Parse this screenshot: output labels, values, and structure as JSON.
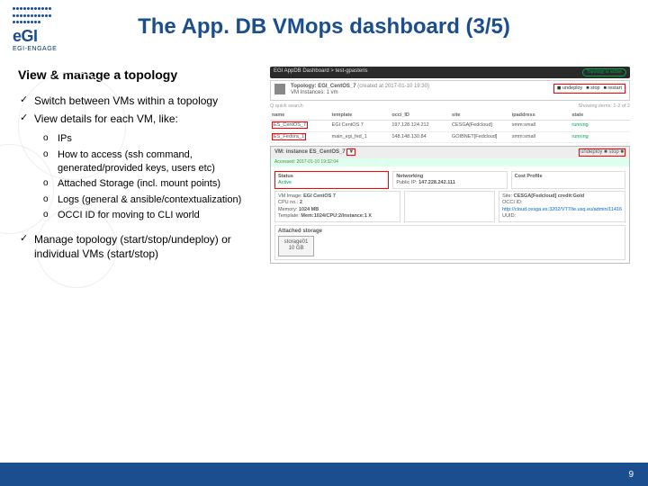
{
  "logo": {
    "text": "eGI",
    "sub": "EGI-ENGAGE"
  },
  "title": "The App. DB VMops dashboard (3/5)",
  "subtitle": "View & manage a topology",
  "bullets": {
    "b1": "Switch between VMs within a topology",
    "b2": "View details for each VM, like:",
    "o1": "IPs",
    "o2": "How to access (ssh command, generated/provided keys, users etc)",
    "o3": "Attached Storage (incl. mount points)",
    "o4": "Logs (general & ansible/contextualization)",
    "o5": "OCCI ID for moving to CLI world",
    "b3": "Manage topology (start/stop/undeploy) or individual VMs (start/stop)"
  },
  "shot": {
    "breadcrumb": "EGI AppDB Dashboard > test-gpasteris",
    "status_pill": "Topology is active",
    "topo_title": "Topology: EGI_CentOS_7",
    "topo_date": "(created at 2017-01-10 19:30)",
    "vm_inst": "VM Instances: 1 vm",
    "actions": {
      "undeploy": "◼ undeploy",
      "stop": "■ stop",
      "restart": "■ restart"
    },
    "quick": "Q quick search",
    "showing": "Showing items: 1-2 of 2",
    "hdr": {
      "name": "name",
      "tmpl": "template",
      "occi": "occi_ID",
      "site": "site",
      "ip": "ipaddress",
      "state": "state"
    },
    "row1": {
      "name": "ES_CentOS_7",
      "tmpl": "EGI CentOS 7",
      "occi": "197.128.124.212",
      "site": "CESGA[Fedcloud]",
      "ip": "smm:small",
      "state": "running"
    },
    "row2": {
      "name": "ES_Fedora_1",
      "tmpl": "main_egi_fed_1",
      "occi": "148.148.130.84",
      "site": "GOIBNET[Fedcloud]",
      "ip": "smm:small",
      "state": "running"
    },
    "vm_title": "VM: instance ES_CentOS_7",
    "vm_sub": "Accessed: 2017-01-10 19:32:04",
    "vm_drop": "▼",
    "actions_r": "undeploy ■ stop ■",
    "sec": {
      "status": "Status",
      "status_v": "Active",
      "net": "Networking",
      "net_l": "Public IP:",
      "net_v": "147.228.242.111",
      "cost": "Cost Profile"
    },
    "rows2": {
      "l1": "VM Image:",
      "v1": "EGI CentOS 7",
      "l2": "CPU no.:",
      "v2": "2",
      "l3": "Memory:",
      "v3": "1024 MB",
      "l4": "Template:",
      "v4": "Mem:1024/CPU:2/Instance:1 X"
    },
    "costrows": {
      "l1": "Site:",
      "v1": "CESGA[Fedcloud] credit:Gold",
      "l2": "OCCI ID:",
      "v2": "http://cloud.cesga.es:3202/VT7/te.usq.eu/admin/11416",
      "l3": "UUID:"
    },
    "storage_title": "Attached storage",
    "disk": {
      "name": "storage01",
      "size": "10 GB"
    }
  },
  "page_num": "9"
}
